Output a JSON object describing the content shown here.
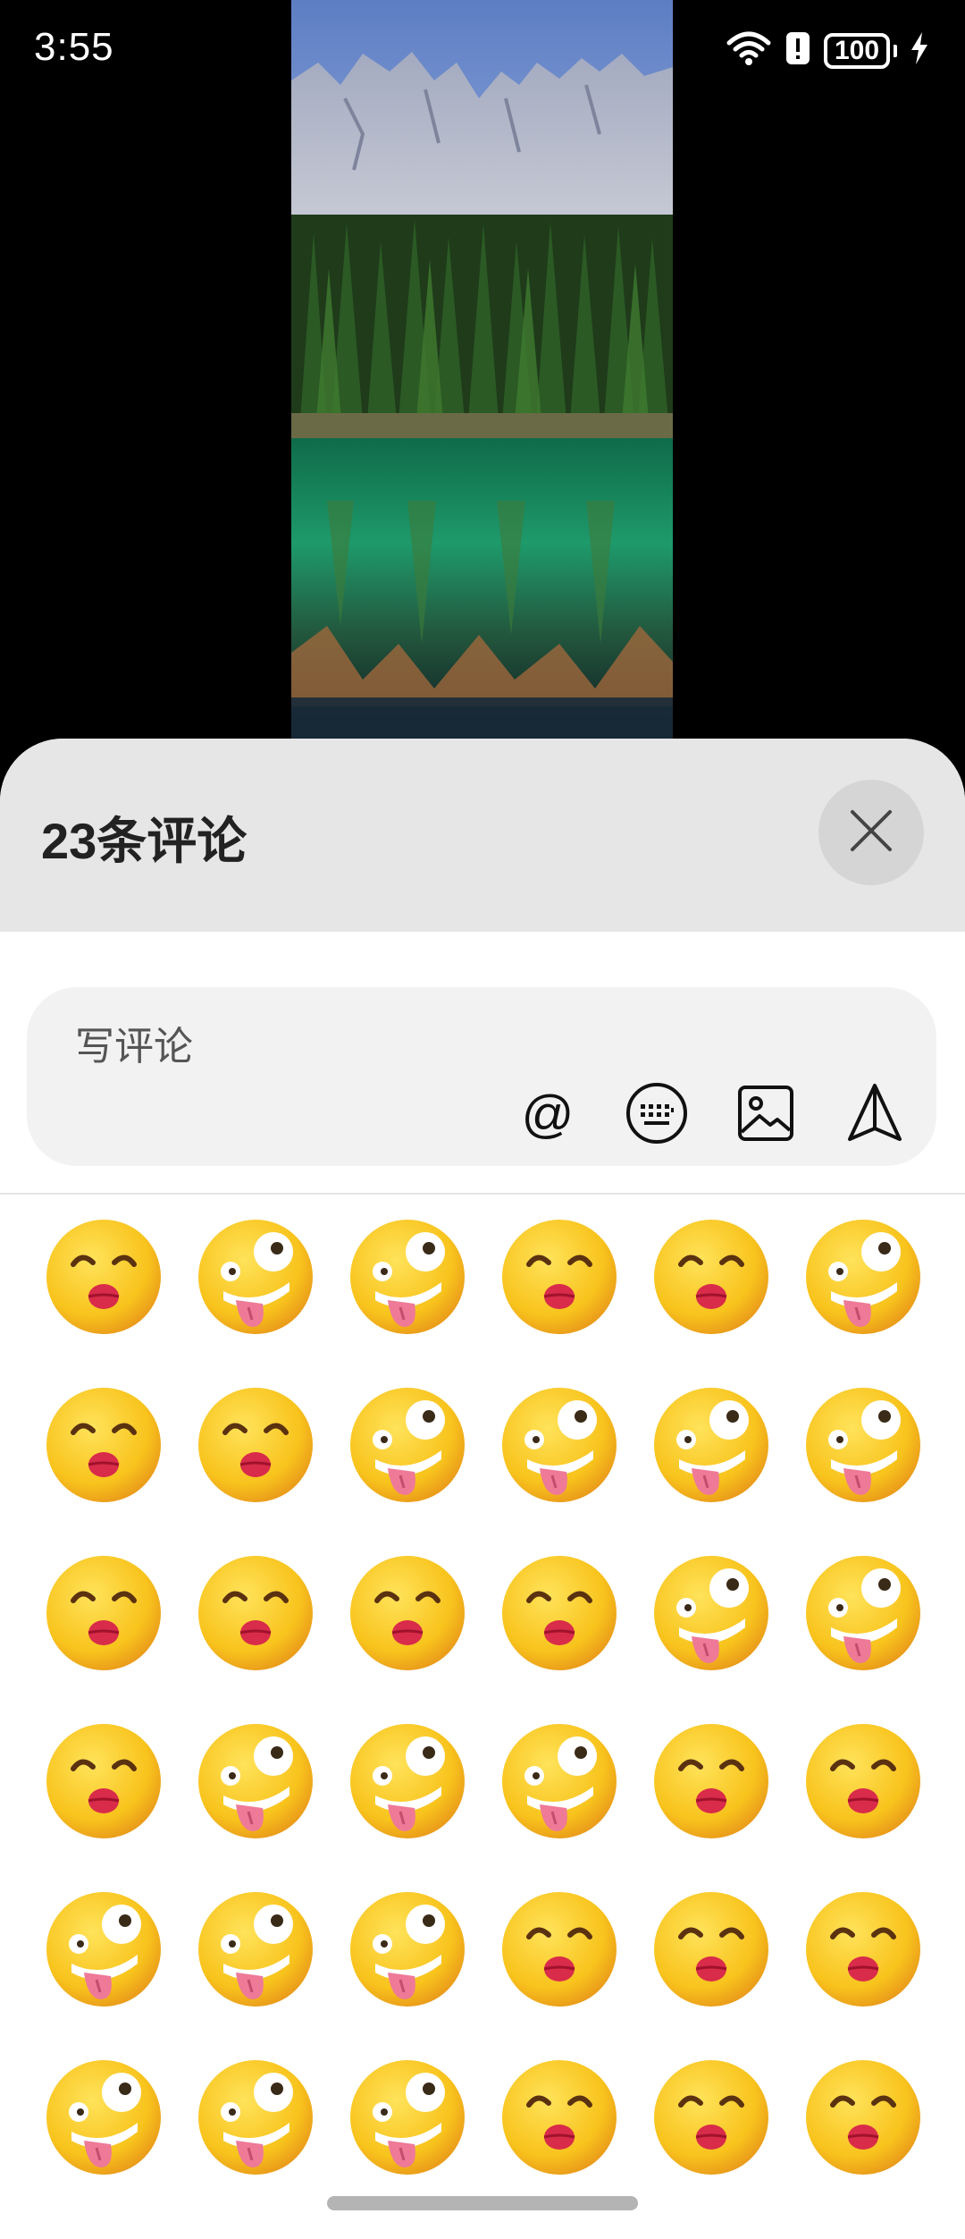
{
  "status_bar": {
    "time": "3:55",
    "battery": "100",
    "icons": [
      "wifi-icon",
      "alert-icon",
      "battery-icon",
      "charging-icon"
    ]
  },
  "media": {
    "description_icon": "landscape-photo"
  },
  "comments": {
    "title": "23条评论",
    "close_icon": "close-icon"
  },
  "composer": {
    "placeholder": "写评论",
    "at_label": "@",
    "tools": [
      "at-icon",
      "keyboard-icon",
      "image-icon",
      "send-icon"
    ]
  },
  "emoji_grid": {
    "rows": [
      [
        "kiss",
        "zany",
        "zany",
        "kiss",
        "kiss",
        "zany"
      ],
      [
        "kiss",
        "kiss",
        "zany",
        "zany",
        "zany",
        "zany"
      ],
      [
        "kiss",
        "kiss",
        "kiss",
        "kiss",
        "zany",
        "zany"
      ],
      [
        "kiss",
        "zany",
        "zany",
        "zany",
        "kiss",
        "kiss"
      ],
      [
        "zany",
        "zany",
        "zany",
        "kiss",
        "kiss",
        "kiss"
      ],
      [
        "zany",
        "zany",
        "zany",
        "kiss",
        "kiss",
        "kiss"
      ]
    ]
  },
  "colors": {
    "sheet_header": "#e6e6e6",
    "input_bg": "#f2f2f2",
    "emoji_yellow": "#f8c31c"
  }
}
